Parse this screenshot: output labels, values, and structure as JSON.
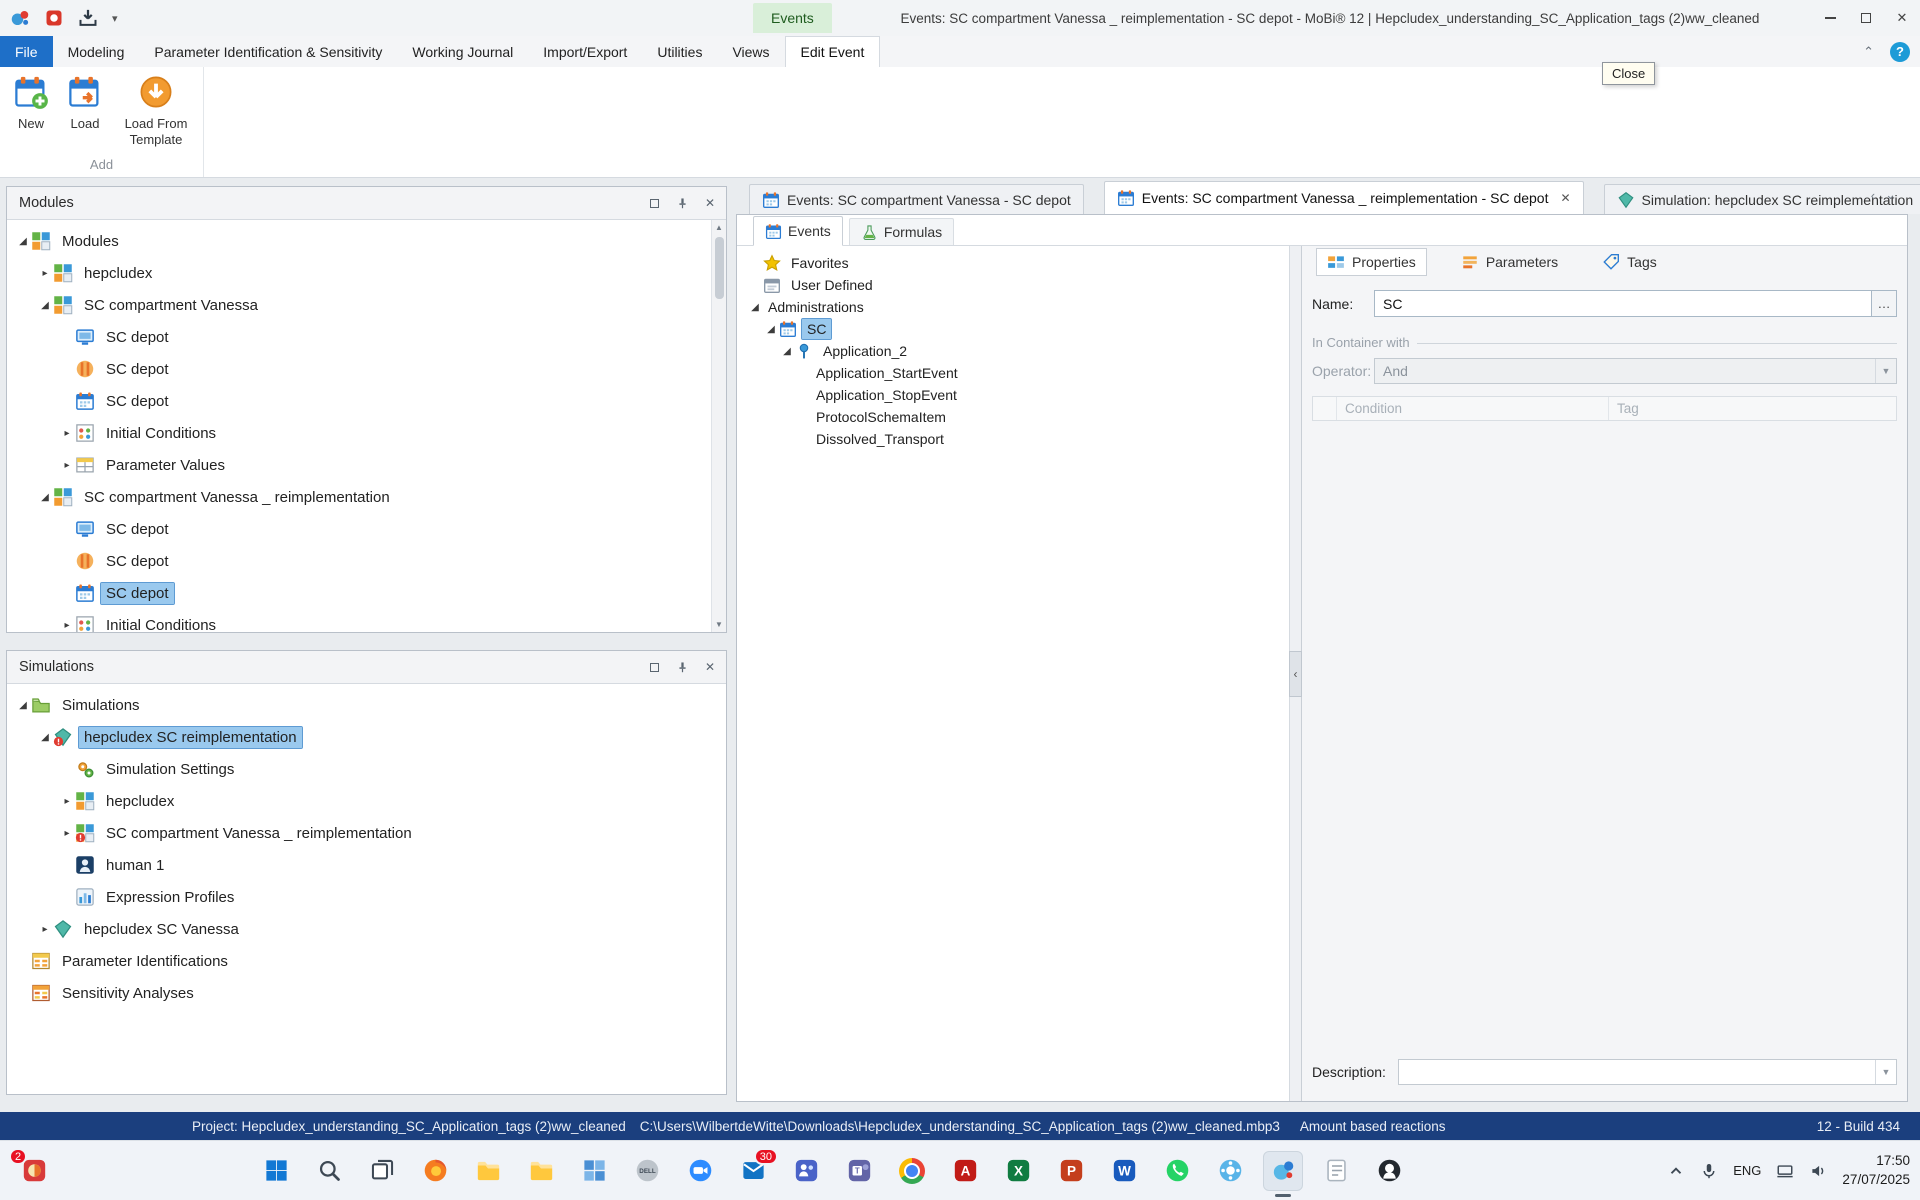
{
  "titlebar": {
    "contextual_group": "Events",
    "title": "Events: SC compartment Vanessa _ reimplementation - SC depot - MoBi® 12 | Hepcludex_understanding_SC_Application_tags (2)ww_cleaned"
  },
  "ribbon": {
    "tabs": [
      {
        "label": "File",
        "active": false
      },
      {
        "label": "Modeling",
        "active": false
      },
      {
        "label": "Parameter Identification & Sensitivity",
        "active": false
      },
      {
        "label": "Working Journal",
        "active": false
      },
      {
        "label": "Import/Export",
        "active": false
      },
      {
        "label": "Utilities",
        "active": false
      },
      {
        "label": "Views",
        "active": false
      },
      {
        "label": "Edit Event",
        "active": true
      }
    ],
    "group_label": "Add",
    "buttons": [
      {
        "label": "New",
        "icon": "new-event"
      },
      {
        "label": "Load",
        "icon": "load-event"
      },
      {
        "label": "Load From Template",
        "icon": "load-template"
      }
    ],
    "tooltip": "Close"
  },
  "modules_panel": {
    "title": "Modules",
    "tree": [
      {
        "indent": 0,
        "expand": "open",
        "icon": "module",
        "label": "Modules"
      },
      {
        "indent": 1,
        "expand": "closed",
        "icon": "module",
        "label": "hepcludex"
      },
      {
        "indent": 1,
        "expand": "open",
        "icon": "module",
        "label": "SC compartment Vanessa"
      },
      {
        "indent": 2,
        "icon": "spatial",
        "label": "SC depot"
      },
      {
        "indent": 2,
        "icon": "transport",
        "label": "SC depot"
      },
      {
        "indent": 2,
        "icon": "calendar",
        "label": "SC depot"
      },
      {
        "indent": 2,
        "expand": "closed",
        "icon": "initcond",
        "label": "Initial Conditions"
      },
      {
        "indent": 2,
        "expand": "closed",
        "icon": "paramvals",
        "label": "Parameter Values"
      },
      {
        "indent": 1,
        "expand": "open",
        "icon": "module",
        "label": "SC compartment Vanessa _ reimplementation"
      },
      {
        "indent": 2,
        "icon": "spatial",
        "label": "SC depot"
      },
      {
        "indent": 2,
        "icon": "transport",
        "label": "SC depot"
      },
      {
        "indent": 2,
        "icon": "calendar",
        "label": "SC depot",
        "selected": true
      },
      {
        "indent": 2,
        "expand": "closed",
        "icon": "initcond",
        "label": "Initial Conditions"
      }
    ]
  },
  "simulations_panel": {
    "title": "Simulations",
    "tree": [
      {
        "indent": 0,
        "expand": "open",
        "icon": "simfolder",
        "label": "Simulations"
      },
      {
        "indent": 1,
        "expand": "open",
        "icon": "simwarn",
        "label": "hepcludex SC reimplementation",
        "selected": true
      },
      {
        "indent": 2,
        "icon": "settings",
        "label": "Simulation Settings"
      },
      {
        "indent": 2,
        "expand": "closed",
        "icon": "module",
        "label": "hepcludex"
      },
      {
        "indent": 2,
        "expand": "closed",
        "icon": "modulewarn",
        "label": "SC compartment Vanessa _ reimplementation"
      },
      {
        "indent": 2,
        "icon": "human",
        "label": "human 1"
      },
      {
        "indent": 2,
        "icon": "expression",
        "label": "Expression Profiles"
      },
      {
        "indent": 1,
        "expand": "closed",
        "icon": "simulation",
        "label": "hepcludex SC Vanessa"
      },
      {
        "indent": 0,
        "icon": "paramident",
        "label": "Parameter Identifications"
      },
      {
        "indent": 0,
        "icon": "sensitivity",
        "label": "Sensitivity Analyses"
      }
    ]
  },
  "document": {
    "tabs": [
      {
        "icon": "calendar",
        "label": "Events: SC compartment Vanessa - SC depot",
        "active": false,
        "closable": false
      },
      {
        "icon": "calendar",
        "label": "Events: SC compartment Vanessa _ reimplementation - SC depot",
        "active": true,
        "closable": true
      },
      {
        "icon": "simulation",
        "label": "Simulation: hepcludex SC reimplementation",
        "active": false,
        "closable": false
      }
    ],
    "subtabs": [
      {
        "icon": "calendar",
        "label": "Events",
        "active": true
      },
      {
        "icon": "flask",
        "label": "Formulas",
        "active": false
      }
    ],
    "events_tree": [
      {
        "indent": 0,
        "icon": "star",
        "label": "Favorites"
      },
      {
        "indent": 0,
        "icon": "userdef",
        "label": "User Defined"
      },
      {
        "indent": 0,
        "expand": "open",
        "label": "Administrations"
      },
      {
        "indent": 1,
        "expand": "open",
        "icon": "calendar",
        "label": "SC",
        "selected": true
      },
      {
        "indent": 2,
        "expand": "open",
        "icon": "apppin",
        "label": "Application_2"
      },
      {
        "indent": 3,
        "label": "Application_StartEvent"
      },
      {
        "indent": 3,
        "label": "Application_StopEvent"
      },
      {
        "indent": 3,
        "label": "ProtocolSchemaItem"
      },
      {
        "indent": 3,
        "label": "Dissolved_Transport"
      }
    ],
    "properties": {
      "tabs": [
        {
          "icon": "propsgrid",
          "label": "Properties",
          "active": true
        },
        {
          "icon": "params",
          "label": "Parameters",
          "active": false
        },
        {
          "icon": "tag",
          "label": "Tags",
          "active": false
        }
      ],
      "name_label": "Name:",
      "name_value": "SC",
      "ellipsis_label": "…",
      "container_group_label": "In Container with",
      "operator_label": "Operator:",
      "operator_value": "And",
      "grid_columns": [
        "Condition",
        "Tag"
      ],
      "description_label": "Description:"
    }
  },
  "statusbar": {
    "project": "Project: Hepcludex_understanding_SC_Application_tags (2)ww_cleaned",
    "path": "C:\\Users\\WilbertdeWitte\\Downloads\\Hepcludex_understanding_SC_Application_tags (2)ww_cleaned.mbp3",
    "mode": "Amount based reactions",
    "build": "12 - Build 434"
  },
  "taskbar": {
    "left_icon": {
      "name": "widgets",
      "badge": "2"
    },
    "icons": [
      {
        "name": "start"
      },
      {
        "name": "search"
      },
      {
        "name": "task-view"
      },
      {
        "name": "firefox"
      },
      {
        "name": "file-explorer"
      },
      {
        "name": "folder"
      },
      {
        "name": "office-hub"
      },
      {
        "name": "dell"
      },
      {
        "name": "zoom"
      },
      {
        "name": "outlook",
        "badge": "30"
      },
      {
        "name": "teams"
      },
      {
        "name": "teams-new"
      },
      {
        "name": "chrome"
      },
      {
        "name": "acrobat"
      },
      {
        "name": "excel"
      },
      {
        "name": "powerpoint"
      },
      {
        "name": "word"
      },
      {
        "name": "whatsapp"
      },
      {
        "name": "pksim"
      },
      {
        "name": "mobi",
        "active": true
      },
      {
        "name": "notepad"
      },
      {
        "name": "github"
      }
    ],
    "language": "ENG",
    "time": "17:50",
    "date": "27/07/2025"
  }
}
